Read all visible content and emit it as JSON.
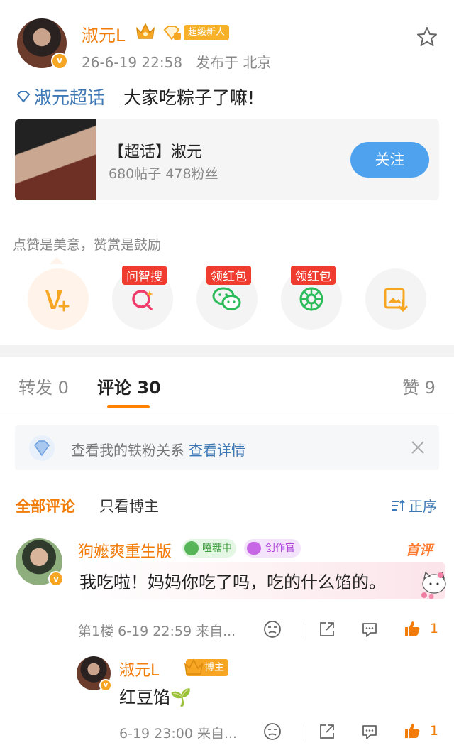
{
  "post": {
    "author_name": "淑元L",
    "newbie_badge": "超级新人",
    "meta": "26-6-19 22:58   发布于 北京",
    "topic_name": "淑元超话",
    "text": "大家吃粽子了嘛!",
    "icons": [
      "avatar",
      "crown-icon",
      "level-gem-icon",
      "star-icon",
      "diamond-icon"
    ]
  },
  "topic_card": {
    "title": "【超话】淑元",
    "subtitle": "680帖子 478粉丝",
    "follow_label": "关注"
  },
  "like_note": "点赞是美意，赞赏是鼓励",
  "actions": [
    {
      "icon": "reward-v-icon",
      "tag": ""
    },
    {
      "icon": "smart-search-icon",
      "tag": "问智搜"
    },
    {
      "icon": "wechat-icon",
      "tag": "领红包"
    },
    {
      "icon": "moments-icon",
      "tag": "领红包"
    },
    {
      "icon": "save-image-icon",
      "tag": ""
    }
  ],
  "tabs": {
    "repost": "转发 0",
    "comments": "评论 30",
    "likes": "赞 9"
  },
  "fan_banner": {
    "text": "查看我的铁粉关系",
    "link": "查看详情"
  },
  "filters": {
    "all": "全部评论",
    "owner_only": "只看博主",
    "sort": "正序"
  },
  "comments": [
    {
      "name": "狗嬷爽重生版",
      "badge_green": "嗑糖中",
      "badge_purple": "创作官",
      "first_label": "首评",
      "text": "我吃啦！妈妈你吃了吗，吃的什么馅的。",
      "meta": "第1楼  6-19 22:59  来自...",
      "likes": "1"
    },
    {
      "name": "淑元L",
      "owner_tag": "博主",
      "text": "红豆馅🌱",
      "meta": "6-19 23:00  来自...",
      "likes": "1"
    }
  ],
  "colors": {
    "accent_orange": "#f27c0a",
    "link_blue": "#3d78b5",
    "follow_blue": "#4fa3ee",
    "red_tag": "#f03b2f"
  }
}
